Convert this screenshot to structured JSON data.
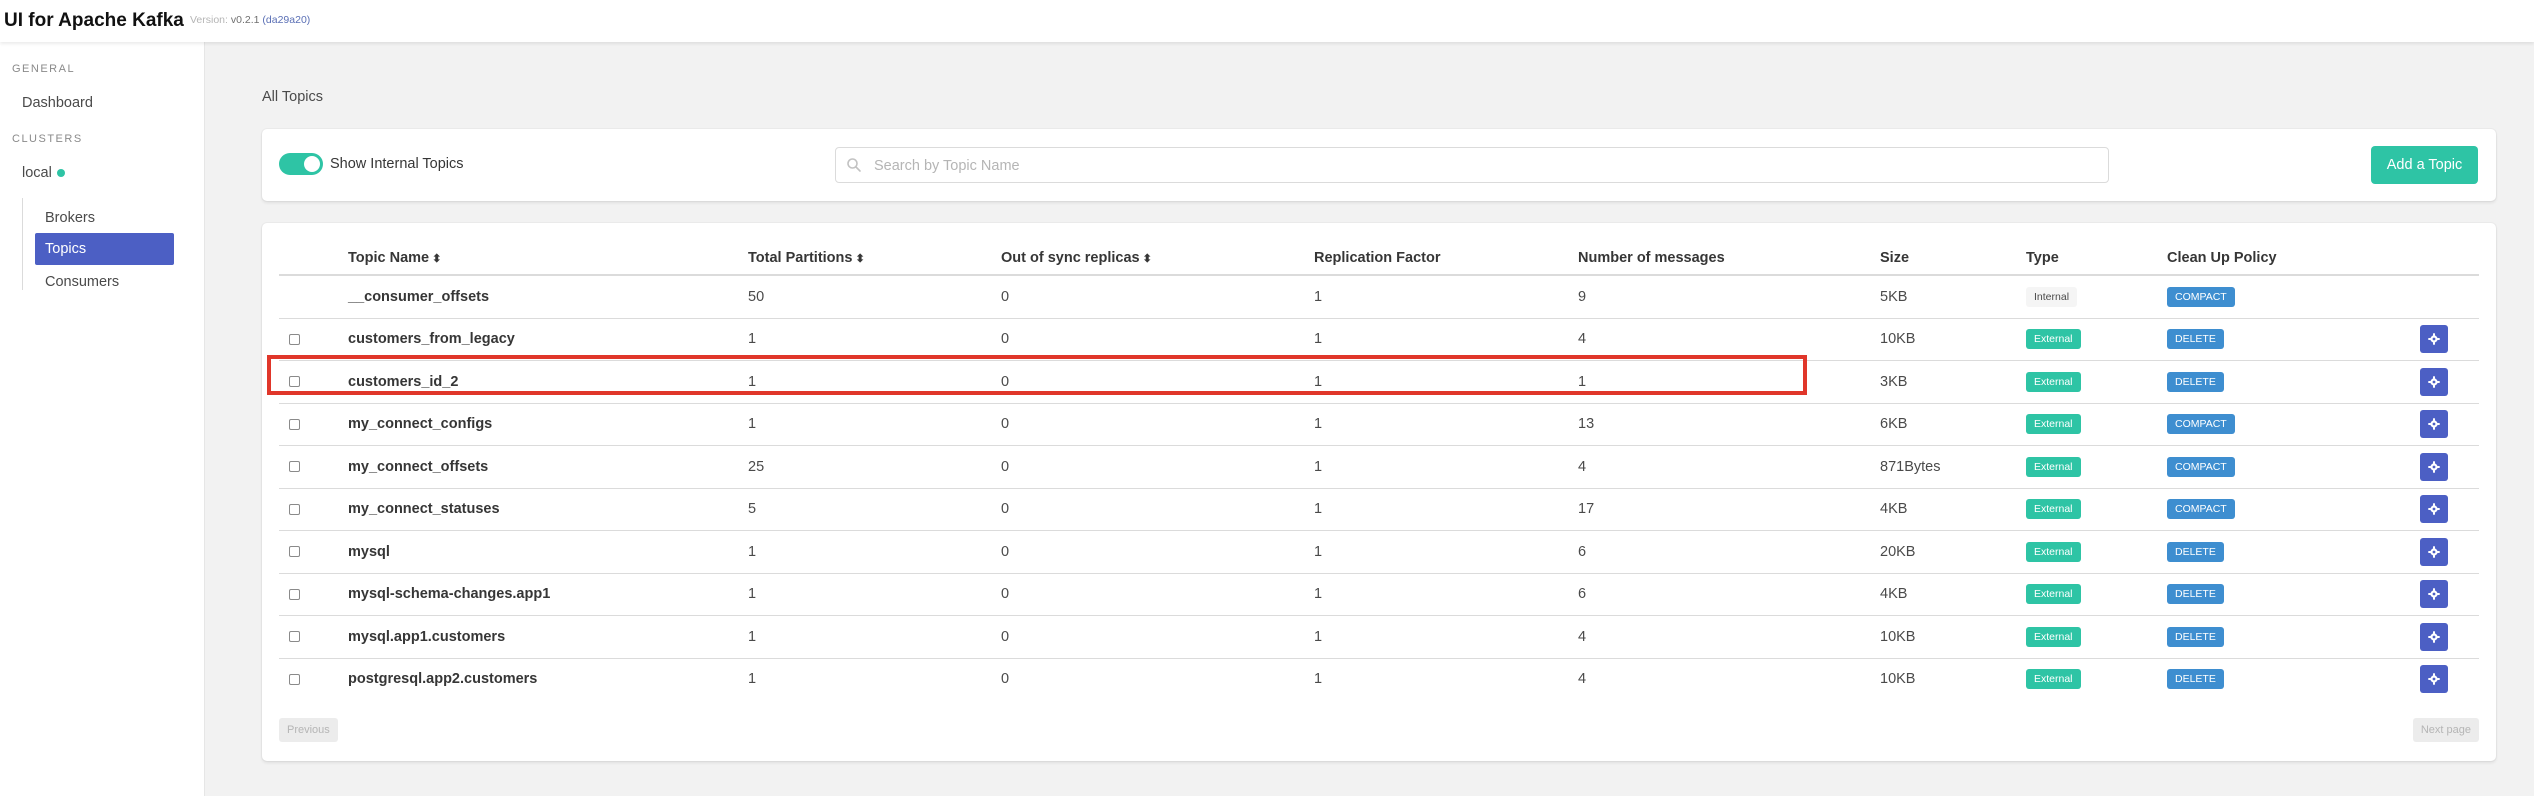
{
  "navbar": {
    "title": "UI for Apache Kafka",
    "version_label": "Version:",
    "version_number": "v0.2.1",
    "version_hash": "(da29a20)"
  },
  "sidebar": {
    "general_label": "GENERAL",
    "dashboard": "Dashboard",
    "clusters_label": "CLUSTERS",
    "cluster_name": "local",
    "cluster_status_color": "#2ec4a5",
    "items": [
      {
        "label": "Brokers",
        "active": false
      },
      {
        "label": "Topics",
        "active": true
      },
      {
        "label": "Consumers",
        "active": false
      }
    ]
  },
  "main": {
    "page_title": "All Topics",
    "toggle_label": "Show Internal Topics",
    "toggle_on": true,
    "search_placeholder": "Search by Topic Name",
    "add_button": "Add a Topic",
    "accent_color": "#2ec4a5",
    "primary_color": "#4c5fc4",
    "highlight_color": "#e0362a"
  },
  "table": {
    "headers": {
      "name": "Topic Name",
      "partitions": "Total Partitions",
      "out_of_sync": "Out of sync replicas",
      "replication": "Replication Factor",
      "messages": "Number of messages",
      "size": "Size",
      "type": "Type",
      "policy": "Clean Up Policy"
    },
    "rows": [
      {
        "name": "__consumer_offsets",
        "partitions": "50",
        "out_of_sync": "0",
        "replication": "1",
        "messages": "9",
        "size": "5KB",
        "type": "Internal",
        "policy": "COMPACT",
        "checkbox": false,
        "actions": false
      },
      {
        "name": "customers_from_legacy",
        "partitions": "1",
        "out_of_sync": "0",
        "replication": "1",
        "messages": "4",
        "size": "10KB",
        "type": "External",
        "policy": "DELETE",
        "checkbox": true,
        "actions": true
      },
      {
        "name": "customers_id_2",
        "partitions": "1",
        "out_of_sync": "0",
        "replication": "1",
        "messages": "1",
        "size": "3KB",
        "type": "External",
        "policy": "DELETE",
        "checkbox": true,
        "actions": true
      },
      {
        "name": "my_connect_configs",
        "partitions": "1",
        "out_of_sync": "0",
        "replication": "1",
        "messages": "13",
        "size": "6KB",
        "type": "External",
        "policy": "COMPACT",
        "checkbox": true,
        "actions": true
      },
      {
        "name": "my_connect_offsets",
        "partitions": "25",
        "out_of_sync": "0",
        "replication": "1",
        "messages": "4",
        "size": "871Bytes",
        "type": "External",
        "policy": "COMPACT",
        "checkbox": true,
        "actions": true
      },
      {
        "name": "my_connect_statuses",
        "partitions": "5",
        "out_of_sync": "0",
        "replication": "1",
        "messages": "17",
        "size": "4KB",
        "type": "External",
        "policy": "COMPACT",
        "checkbox": true,
        "actions": true
      },
      {
        "name": "mysql",
        "partitions": "1",
        "out_of_sync": "0",
        "replication": "1",
        "messages": "6",
        "size": "20KB",
        "type": "External",
        "policy": "DELETE",
        "checkbox": true,
        "actions": true
      },
      {
        "name": "mysql-schema-changes.app1",
        "partitions": "1",
        "out_of_sync": "0",
        "replication": "1",
        "messages": "6",
        "size": "4KB",
        "type": "External",
        "policy": "DELETE",
        "checkbox": true,
        "actions": true
      },
      {
        "name": "mysql.app1.customers",
        "partitions": "1",
        "out_of_sync": "0",
        "replication": "1",
        "messages": "4",
        "size": "10KB",
        "type": "External",
        "policy": "DELETE",
        "checkbox": true,
        "actions": true
      },
      {
        "name": "postgresql.app2.customers",
        "partitions": "1",
        "out_of_sync": "0",
        "replication": "1",
        "messages": "4",
        "size": "10KB",
        "type": "External",
        "policy": "DELETE",
        "checkbox": true,
        "actions": true
      }
    ]
  },
  "pagination": {
    "previous": "Previous",
    "next": "Next page"
  }
}
